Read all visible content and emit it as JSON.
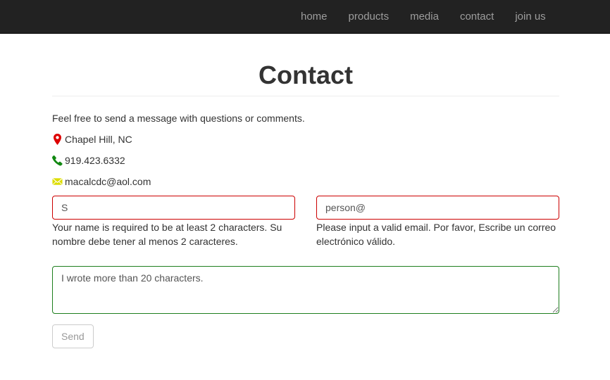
{
  "navbar": {
    "links": [
      {
        "label": "home"
      },
      {
        "label": "products"
      },
      {
        "label": "media"
      },
      {
        "label": "contact"
      },
      {
        "label": "join us"
      }
    ]
  },
  "page": {
    "title": "Contact",
    "intro": "Feel free to send a message with questions or comments."
  },
  "contact_info": {
    "location": "Chapel Hill, NC",
    "phone": "919.423.6332",
    "email": "macalcdc@aol.com"
  },
  "form": {
    "name": {
      "value": "S",
      "error": "Your name is required to be at least 2 characters. Su nombre debe tener al menos 2 caracteres."
    },
    "email": {
      "value": "person@",
      "error": "Please input a valid email. Por favor, Escribe un correo electrónico válido."
    },
    "message": {
      "value": "I wrote more than 20 characters."
    },
    "send_label": "Send"
  },
  "colors": {
    "navbar_bg": "#222222",
    "nav_link": "#9d9d9d",
    "error_border": "#cc0000",
    "success_border": "#1e7e1e",
    "location_icon": "#dd0000",
    "phone_icon": "#118811",
    "email_icon": "#dddd00"
  },
  "icons": {
    "location": "map-marker-icon",
    "phone": "phone-icon",
    "email": "envelope-icon"
  }
}
